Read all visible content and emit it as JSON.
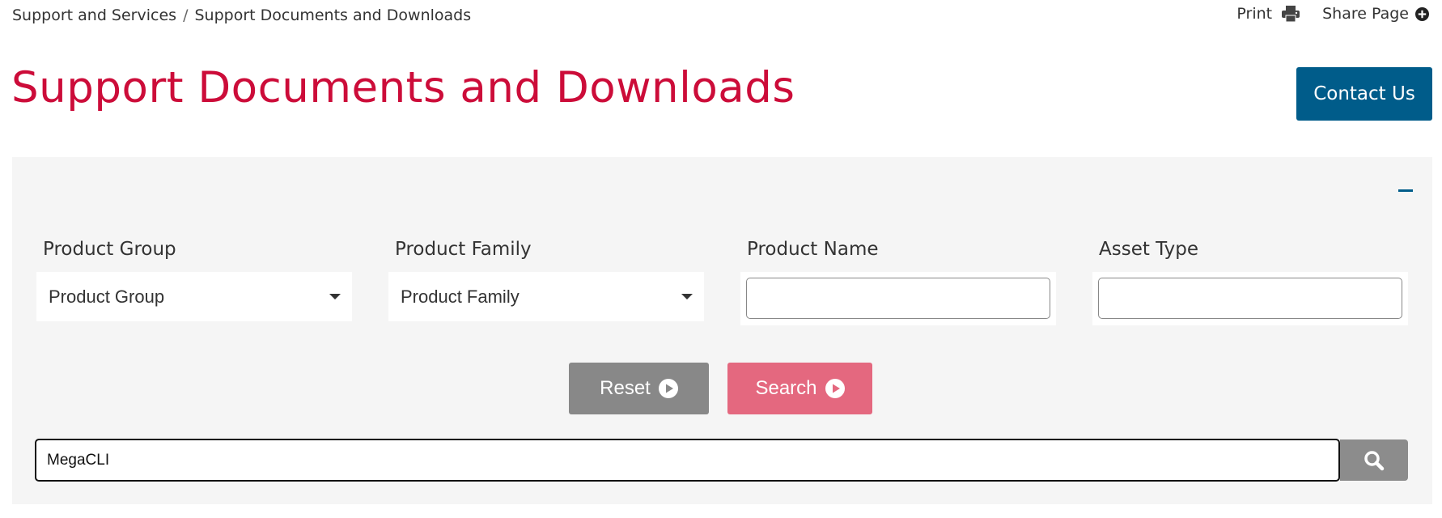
{
  "breadcrumb": {
    "items": [
      "Support and Services",
      "Support Documents and Downloads"
    ],
    "separator": "/"
  },
  "top_actions": {
    "print_label": "Print",
    "share_label": "Share Page"
  },
  "page": {
    "title": "Support Documents and Downloads",
    "contact_label": "Contact Us"
  },
  "filters": {
    "product_group": {
      "label": "Product Group",
      "value": "Product Group"
    },
    "product_family": {
      "label": "Product Family",
      "value": "Product Family"
    },
    "product_name": {
      "label": "Product Name",
      "value": ""
    },
    "asset_type": {
      "label": "Asset Type",
      "value": ""
    }
  },
  "buttons": {
    "reset_label": "Reset",
    "search_label": "Search"
  },
  "keyword": {
    "value": "MegaCLI"
  },
  "colors": {
    "brand_red": "#cc0c39",
    "brand_blue": "#005c8a",
    "reset_gray": "#888888",
    "search_pink": "#e4687f"
  }
}
